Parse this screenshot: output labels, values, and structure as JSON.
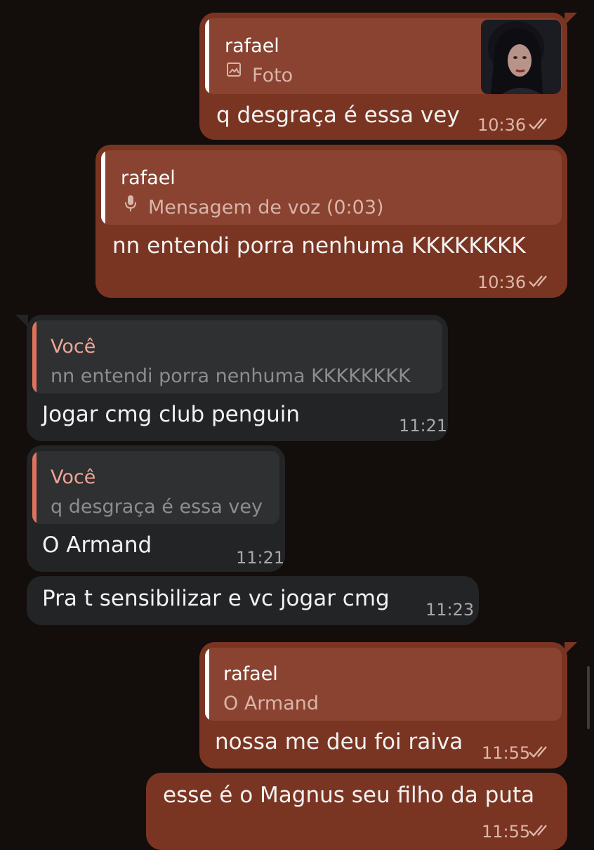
{
  "messages": [
    {
      "reply_name": "rafael",
      "reply_text": "Foto",
      "reply_icon": "image-icon",
      "text": "q desgraça é essa vey",
      "time": "10:36"
    },
    {
      "reply_name": "rafael",
      "reply_text": "Mensagem de voz (0:03)",
      "reply_icon": "mic-icon",
      "text": "nn entendi porra nenhuma KKKKKKKK",
      "time": "10:36"
    },
    {
      "reply_name": "Você",
      "reply_text": "nn entendi porra nenhuma KKKKKKKK",
      "text": "Jogar cmg club penguin",
      "time": "11:21"
    },
    {
      "reply_name": "Você",
      "reply_text": "q desgraça é essa vey",
      "text": "O Armand",
      "time": "11:21"
    },
    {
      "text": "Pra t sensibilizar e vc jogar cmg",
      "time": "11:23"
    },
    {
      "reply_name": "rafael",
      "reply_text": "O Armand",
      "text": "nossa me deu foi raiva",
      "time": "11:55"
    },
    {
      "text": "esse é o Magnus seu filho da puta",
      "time": "11:55"
    }
  ],
  "colors": {
    "background": "#130d0b",
    "outgoing_bubble": "#7a3522",
    "incoming_bubble": "#232426",
    "incoming_reply_accent": "#e0735b"
  }
}
